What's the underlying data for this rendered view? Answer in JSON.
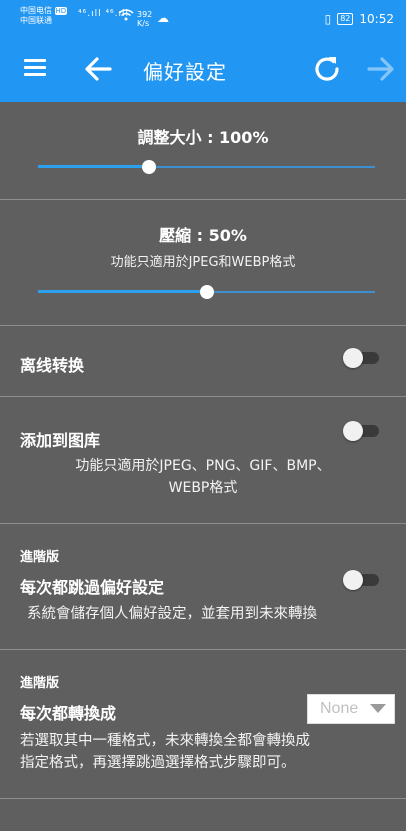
{
  "status_bar": {
    "carrier1": "中国电信",
    "carrier2": "中国联通",
    "hd": "HD",
    "signal": "⁴⁶.ıll ⁴⁶.ıll",
    "speed_value": "392",
    "speed_unit": "K/s",
    "battery": "82",
    "time": "10:52"
  },
  "app_bar": {
    "title": "偏好設定"
  },
  "resize": {
    "label": "調整大小 : 100%",
    "value_fraction": 0.33
  },
  "compress": {
    "label": "壓縮 : 50%",
    "note": "功能只適用於JPEG和WEBP格式",
    "value_fraction": 0.5
  },
  "offline": {
    "label": "离线转换",
    "on": false
  },
  "gallery": {
    "label": "添加到图库",
    "note_line1": "功能只適用於JPEG、PNG、GIF、BMP、",
    "note_line2": "WEBP格式",
    "on": false
  },
  "skip_pref": {
    "badge": "進階版",
    "label": "每次都跳過偏好設定",
    "desc": "系統會儲存個人偏好設定，並套用到未來轉換",
    "on": false
  },
  "convert_to": {
    "badge": "進階版",
    "label": "每次都轉換成",
    "selected": "None",
    "desc_line1": "若選取其中一種格式，未來轉換全都會轉換成",
    "desc_line2": "指定格式，再選擇跳過選擇格式步驟即可。"
  },
  "colors": {
    "accent": "#2196f3",
    "background": "#5f5f5f"
  }
}
